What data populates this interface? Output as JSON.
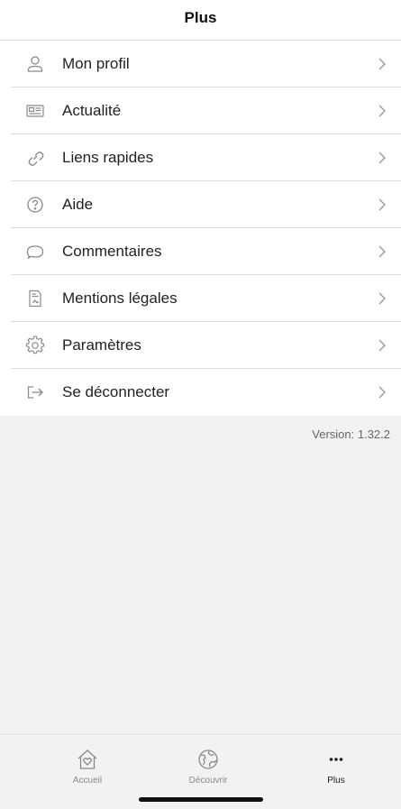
{
  "header": {
    "title": "Plus"
  },
  "menu": {
    "items": [
      {
        "label": "Mon profil",
        "icon": "user-icon"
      },
      {
        "label": "Actualité",
        "icon": "news-icon"
      },
      {
        "label": "Liens rapides",
        "icon": "link-icon"
      },
      {
        "label": "Aide",
        "icon": "help-icon"
      },
      {
        "label": "Commentaires",
        "icon": "comment-icon"
      },
      {
        "label": "Mentions légales",
        "icon": "document-icon"
      },
      {
        "label": "Paramètres",
        "icon": "gear-icon"
      },
      {
        "label": "Se déconnecter",
        "icon": "logout-icon"
      }
    ]
  },
  "footer": {
    "version": "Version: 1.32.2"
  },
  "tabbar": {
    "tabs": [
      {
        "label": "Accueil",
        "icon": "home-icon",
        "active": false
      },
      {
        "label": "Découvrir",
        "icon": "globe-icon",
        "active": false
      },
      {
        "label": "Plus",
        "icon": "more-icon",
        "active": true
      }
    ]
  },
  "colors": {
    "background": "#f2f2f2",
    "surface": "#ffffff",
    "icon_gray": "#8a8a8a",
    "text": "#222222"
  }
}
